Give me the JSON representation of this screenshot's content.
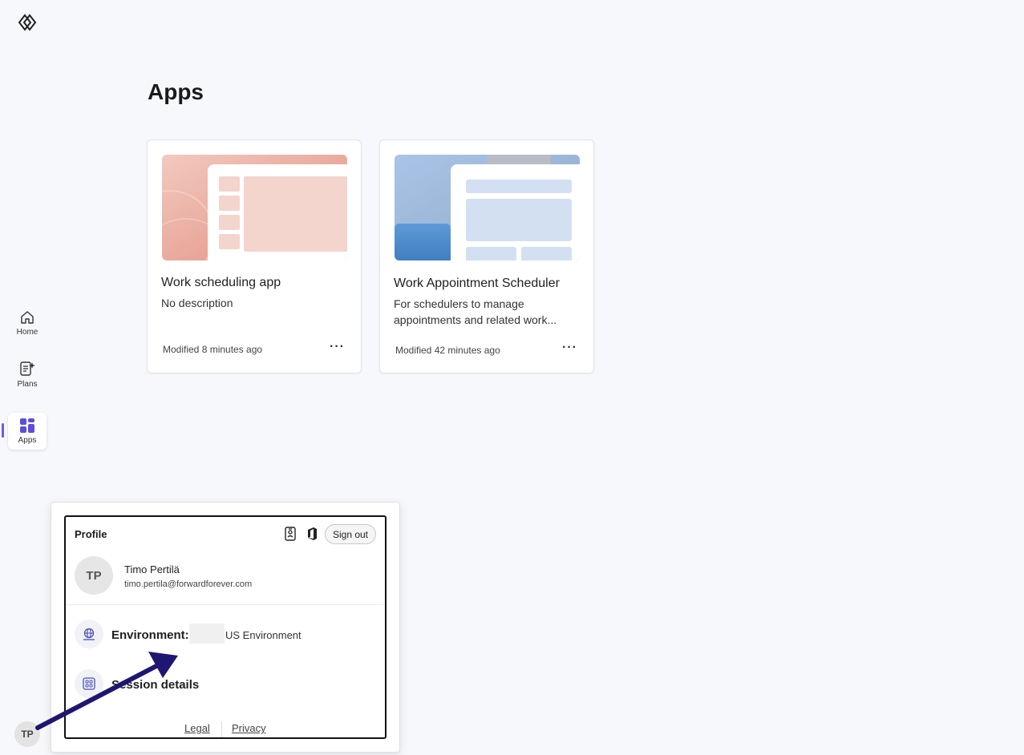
{
  "page": {
    "title": "Apps"
  },
  "nav": {
    "items": [
      {
        "label": "Home",
        "icon": "home-icon"
      },
      {
        "label": "Plans",
        "icon": "plans-icon"
      },
      {
        "label": "Apps",
        "icon": "apps-icon",
        "active": true
      }
    ]
  },
  "apps": [
    {
      "title": "Work scheduling app",
      "description": "No description",
      "modified": "Modified 8 minutes ago",
      "more": "···"
    },
    {
      "title": "Work Appointment Scheduler",
      "description": "For schedulers to manage appointments and related work...",
      "modified": "Modified 42 minutes ago",
      "more": "···"
    }
  ],
  "profile": {
    "title": "Profile",
    "sign_out": "Sign out",
    "initials": "TP",
    "name": "Timo Pertilä",
    "email": "timo.pertila@forwardforever.com",
    "environment_label": "Environment:",
    "environment_value": "US Environment",
    "session_details": "Session details",
    "legal": "Legal",
    "privacy": "Privacy"
  },
  "user": {
    "initials": "TP"
  },
  "colors": {
    "accent": "#6b5ce7",
    "background": "#f7f8fc",
    "arrow": "#1e1670"
  }
}
